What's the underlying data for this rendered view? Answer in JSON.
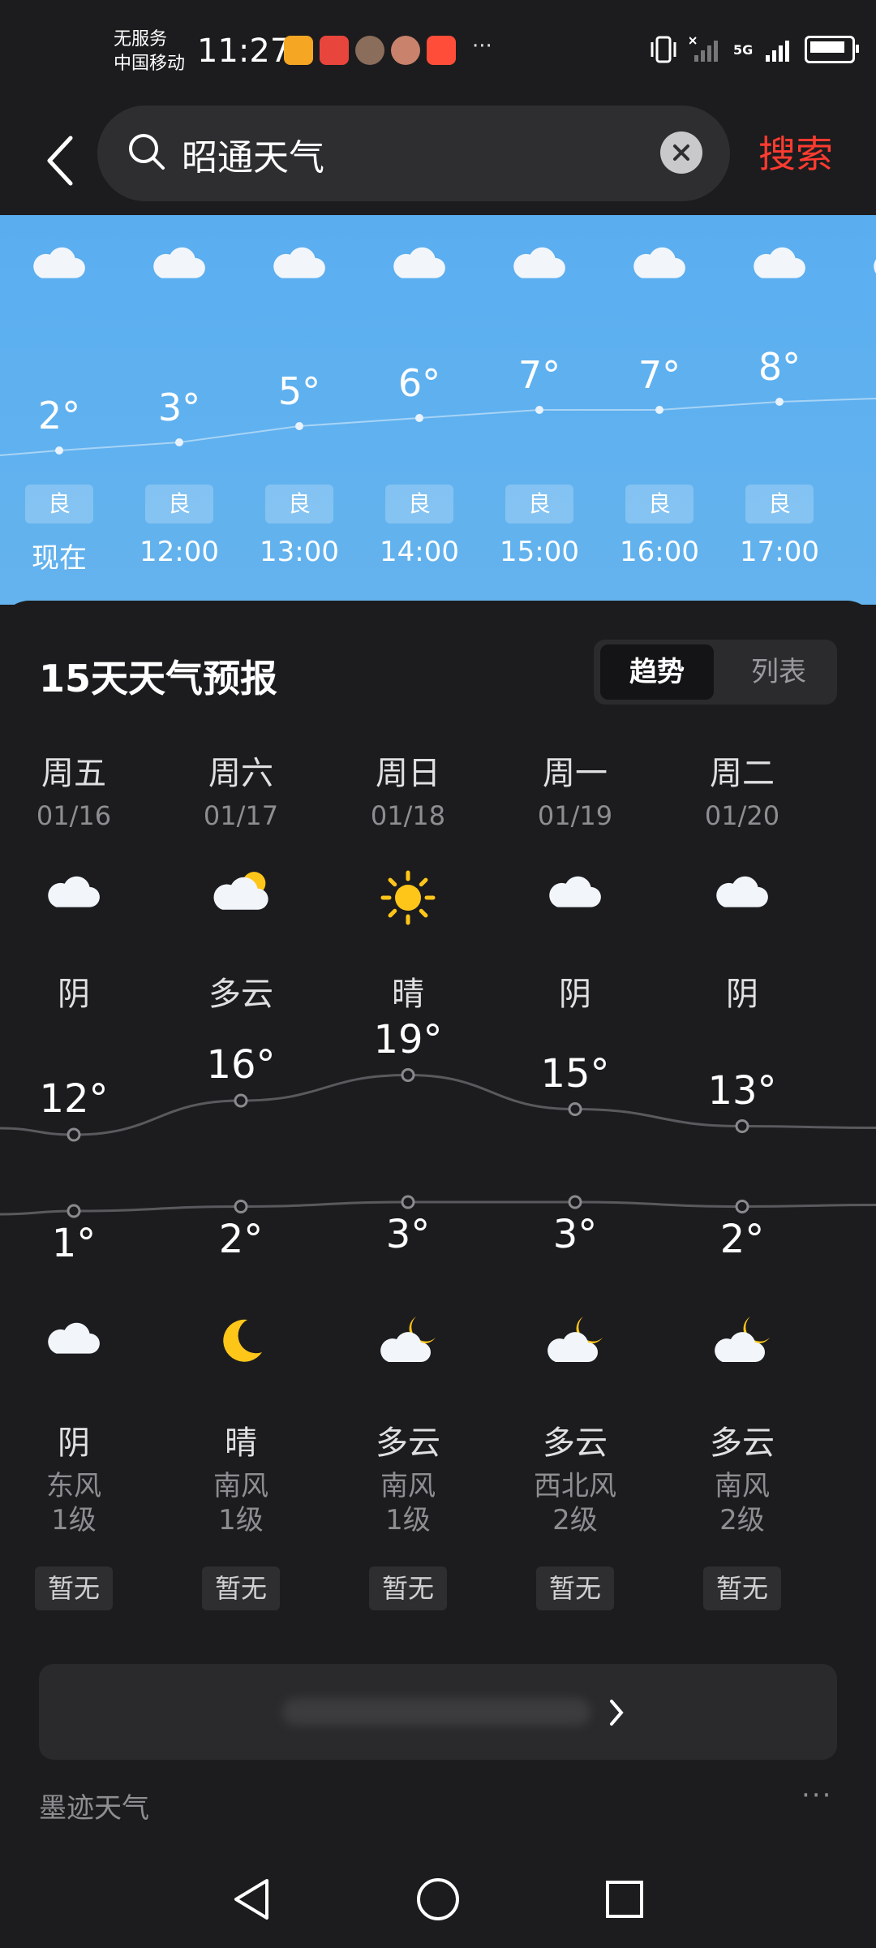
{
  "status_bar": {
    "carrier_line1": "无服务",
    "carrier_line2": "中国移动",
    "time": "11:27",
    "overflow": "···",
    "network": "5G"
  },
  "search": {
    "query": "昭通天气",
    "action": "搜索"
  },
  "hourly": [
    {
      "time": "现在",
      "temp": "2°",
      "aqi": "良",
      "temp_value": 2
    },
    {
      "time": "12:00",
      "temp": "3°",
      "aqi": "良",
      "temp_value": 3
    },
    {
      "time": "13:00",
      "temp": "5°",
      "aqi": "良",
      "temp_value": 5
    },
    {
      "time": "14:00",
      "temp": "6°",
      "aqi": "良",
      "temp_value": 6
    },
    {
      "time": "15:00",
      "temp": "7°",
      "aqi": "良",
      "temp_value": 7
    },
    {
      "time": "16:00",
      "temp": "7°",
      "aqi": "良",
      "temp_value": 7
    },
    {
      "time": "17:00",
      "temp": "8°",
      "aqi": "良",
      "temp_value": 8
    }
  ],
  "forecast": {
    "title": "15天天气预报",
    "toggle_active": "趋势",
    "toggle_inactive": "列表",
    "days": [
      {
        "weekday": "周五",
        "date": "01/16",
        "day_icon": "cloudy-icon",
        "day_cond": "阴",
        "high": "12°",
        "high_value": 12,
        "low": "1°",
        "low_value": 1,
        "night_icon": "cloudy-icon",
        "night_cond": "阴",
        "wind_dir": "东风",
        "wind_level": "1级",
        "aqi": "暂无"
      },
      {
        "weekday": "周六",
        "date": "01/17",
        "day_icon": "partly-cloudy-day-icon",
        "day_cond": "多云",
        "high": "16°",
        "high_value": 16,
        "low": "2°",
        "low_value": 2,
        "night_icon": "moon-icon",
        "night_cond": "晴",
        "wind_dir": "南风",
        "wind_level": "1级",
        "aqi": "暂无"
      },
      {
        "weekday": "周日",
        "date": "01/18",
        "day_icon": "sun-icon",
        "day_cond": "晴",
        "high": "19°",
        "high_value": 19,
        "low": "3°",
        "low_value": 3,
        "night_icon": "partly-cloudy-night-icon",
        "night_cond": "多云",
        "wind_dir": "南风",
        "wind_level": "1级",
        "aqi": "暂无"
      },
      {
        "weekday": "周一",
        "date": "01/19",
        "day_icon": "cloudy-icon",
        "day_cond": "阴",
        "high": "15°",
        "high_value": 15,
        "low": "3°",
        "low_value": 3,
        "night_icon": "partly-cloudy-night-icon",
        "night_cond": "多云",
        "wind_dir": "西北风",
        "wind_level": "2级",
        "aqi": "暂无"
      },
      {
        "weekday": "周二",
        "date": "01/20",
        "day_icon": "cloudy-icon",
        "day_cond": "阴",
        "high": "13°",
        "high_value": 13,
        "low": "2°",
        "low_value": 2,
        "night_icon": "partly-cloudy-night-icon",
        "night_cond": "多云",
        "wind_dir": "南风",
        "wind_level": "2级",
        "aqi": "暂无"
      }
    ]
  },
  "footer": {
    "source": "墨迹天气",
    "more": "···"
  },
  "colors": {
    "accent": "#ff3b30",
    "sky": "#5aaef0",
    "card": "#1c1c1e",
    "sun": "#ffc61a"
  }
}
